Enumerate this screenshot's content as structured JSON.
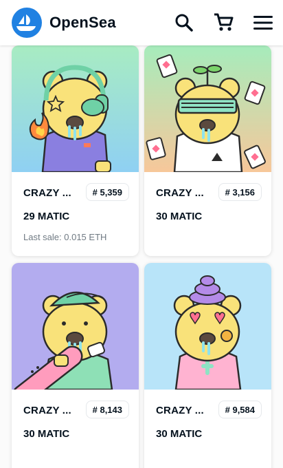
{
  "header": {
    "brand": "OpenSea",
    "icons": [
      "search-icon",
      "cart-icon",
      "menu-icon"
    ],
    "accent": "#2081e2"
  },
  "cards": [
    {
      "name": "CRAZY ...",
      "token": "# 5,359",
      "price": "29 MATIC",
      "last_sale": "Last sale: 0.015 ETH"
    },
    {
      "name": "CRAZY ...",
      "token": "# 3,156",
      "price": "30 MATIC"
    },
    {
      "name": "CRAZY ...",
      "token": "# 8,143",
      "price": "30 MATIC"
    },
    {
      "name": "CRAZY ...",
      "token": "# 9,584",
      "price": "30 MATIC"
    }
  ]
}
